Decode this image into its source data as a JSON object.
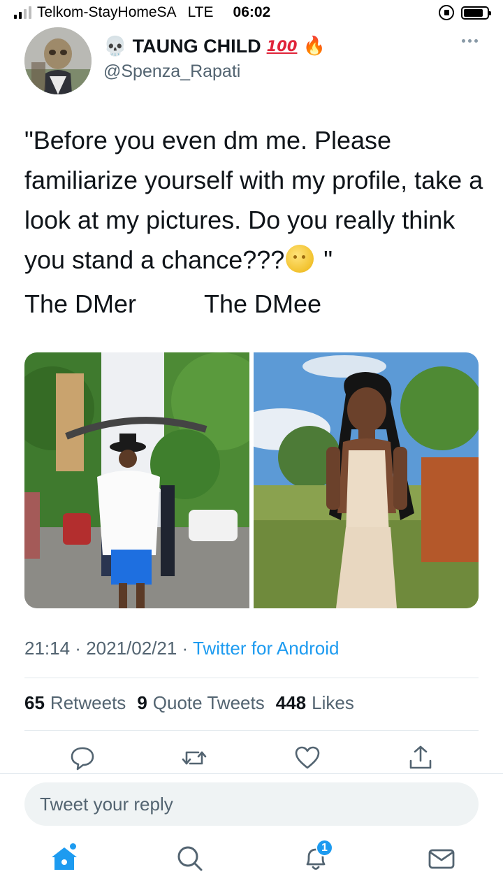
{
  "status_bar": {
    "carrier": "Telkom-StayHomeSA",
    "network": "LTE",
    "time": "06:02",
    "battery_level": 0.85,
    "signal_bars": 2
  },
  "tweet": {
    "display_name": "TAUNG CHILD",
    "name_emojis": {
      "skull": "💀",
      "hundred": "100",
      "fire": "🔥"
    },
    "handle": "@Spenza_Rapati",
    "text_before_emoji": "\"Before you even dm me. Please familiarize yourself with my profile, take a look at my pictures. Do you really think you stand a chance???",
    "emoji_name": "moon-face-emoji",
    "text_after_emoji": " \"",
    "label_left": "The DMer",
    "label_right": "The DMee",
    "time": "21:14",
    "date": "2021/02/21",
    "separator": " · ",
    "source": "Twitter for Android"
  },
  "stats": {
    "retweets_count": "65",
    "retweets_label": "Retweets",
    "quotes_count": "9",
    "quotes_label": "Quote Tweets",
    "likes_count": "448",
    "likes_label": "Likes"
  },
  "reply": {
    "placeholder": "Tweet your reply"
  },
  "tabbar": {
    "notifications_badge": "1"
  },
  "colors": {
    "accent": "#1d9bf0",
    "secondary_text": "#536471",
    "divider": "#e1e8ed",
    "icon_gray": "#536471"
  }
}
